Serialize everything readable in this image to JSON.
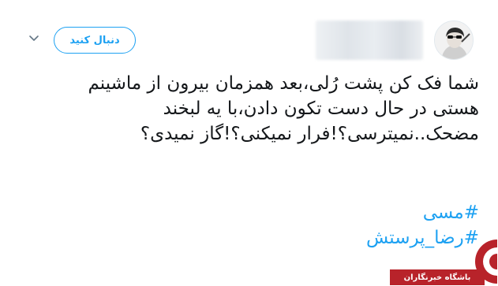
{
  "header": {
    "follow_label": "دنبال کنید",
    "icons": {
      "chevron": "chevron-down-icon",
      "avatar": "avatar"
    }
  },
  "tweet": {
    "text": "شما فک کن پشت رُلی،بعد همزمان بیرون از ماشینم هستی در حال دست تکون دادن،با یه لبخند مضحک..نمیترسی؟!فرار نمیکنی؟!گاز نمیدی؟",
    "hashtags": [
      "#مسی",
      "#رضا_پرستش"
    ]
  },
  "watermark": {
    "label": "باشگاه خبرنگاران"
  },
  "colors": {
    "accent": "#1da1f2",
    "text": "#14171a",
    "muted": "#657786",
    "watermark": "#b8232a"
  }
}
